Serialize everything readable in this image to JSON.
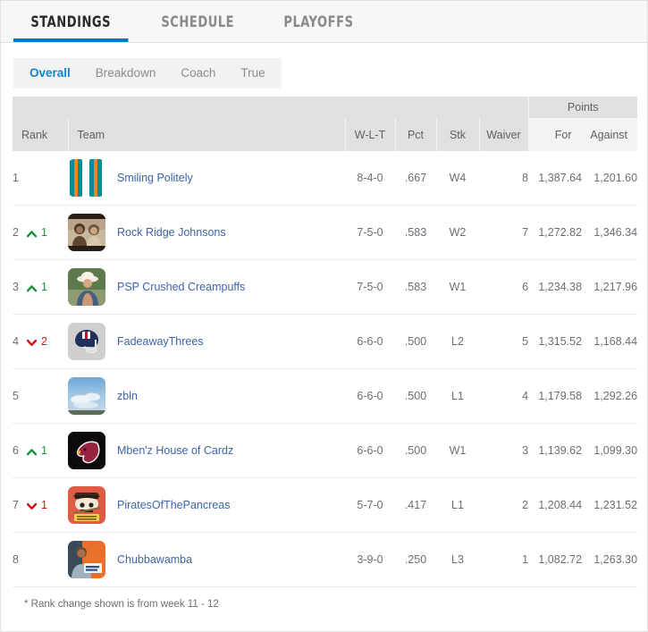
{
  "main_tabs": [
    {
      "label": "STANDINGS",
      "active": true
    },
    {
      "label": "SCHEDULE",
      "active": false
    },
    {
      "label": "PLAYOFFS",
      "active": false
    }
  ],
  "sub_tabs": [
    {
      "label": "Overall",
      "active": true
    },
    {
      "label": "Breakdown",
      "active": false
    },
    {
      "label": "Coach",
      "active": false
    },
    {
      "label": "True",
      "active": false
    }
  ],
  "table": {
    "group_header": "Points",
    "columns": {
      "rank": "Rank",
      "team": "Team",
      "record": "W-L-T",
      "pct": "Pct",
      "stk": "Stk",
      "waiver": "Waiver",
      "points_for": "For",
      "points_against": "Against"
    },
    "rows": [
      {
        "rank": "1",
        "delta_dir": "none",
        "delta": "",
        "team": "Smiling Politely",
        "record": "8-4-0",
        "pct": ".667",
        "stk": "W4",
        "waiver": "8",
        "pf": "1,387.64",
        "pa": "1,201.60",
        "avatar": "stripes-teal-orange"
      },
      {
        "rank": "2",
        "delta_dir": "up",
        "delta": "1",
        "team": "Rock Ridge Johnsons",
        "record": "7-5-0",
        "pct": ".583",
        "stk": "W2",
        "waiver": "7",
        "pf": "1,272.82",
        "pa": "1,346.34",
        "avatar": "photo-sepia-two-people"
      },
      {
        "rank": "3",
        "delta_dir": "up",
        "delta": "1",
        "team": "PSP Crushed Creampuffs",
        "record": "7-5-0",
        "pct": ".583",
        "stk": "W1",
        "waiver": "6",
        "pf": "1,234.38",
        "pa": "1,217.96",
        "avatar": "photo-person-white-hat"
      },
      {
        "rank": "4",
        "delta_dir": "down",
        "delta": "2",
        "team": "FadeawayThrees",
        "record": "6-6-0",
        "pct": ".500",
        "stk": "L2",
        "waiver": "5",
        "pf": "1,315.52",
        "pa": "1,168.44",
        "avatar": "nfl-helmet"
      },
      {
        "rank": "5",
        "delta_dir": "none",
        "delta": "",
        "team": "zbln",
        "record": "6-6-0",
        "pct": ".500",
        "stk": "L1",
        "waiver": "4",
        "pf": "1,179.58",
        "pa": "1,292.26",
        "avatar": "sky-clouds"
      },
      {
        "rank": "6",
        "delta_dir": "up",
        "delta": "1",
        "team": "Mben'z House of Cardz",
        "record": "6-6-0",
        "pct": ".500",
        "stk": "W1",
        "waiver": "3",
        "pf": "1,139.62",
        "pa": "1,099.30",
        "avatar": "cardinals-logo"
      },
      {
        "rank": "7",
        "delta_dir": "down",
        "delta": "1",
        "team": "PiratesOfThePancreas",
        "record": "5-7-0",
        "pct": ".417",
        "stk": "L1",
        "waiver": "2",
        "pf": "1,208.44",
        "pa": "1,231.52",
        "avatar": "pirate-skull"
      },
      {
        "rank": "8",
        "delta_dir": "none",
        "delta": "",
        "team": "Chubbawamba",
        "record": "3-9-0",
        "pct": ".250",
        "stk": "L3",
        "waiver": "1",
        "pf": "1,082.72",
        "pa": "1,263.30",
        "avatar": "photo-person-orange"
      }
    ]
  },
  "footnote": "* Rank change shown is from week 11 - 12",
  "colors": {
    "accent_blue": "#0b78be",
    "link_blue": "#3c64a8",
    "up_green": "#16923a",
    "down_red": "#cf1111",
    "header_gray": "#e0e0e0"
  }
}
